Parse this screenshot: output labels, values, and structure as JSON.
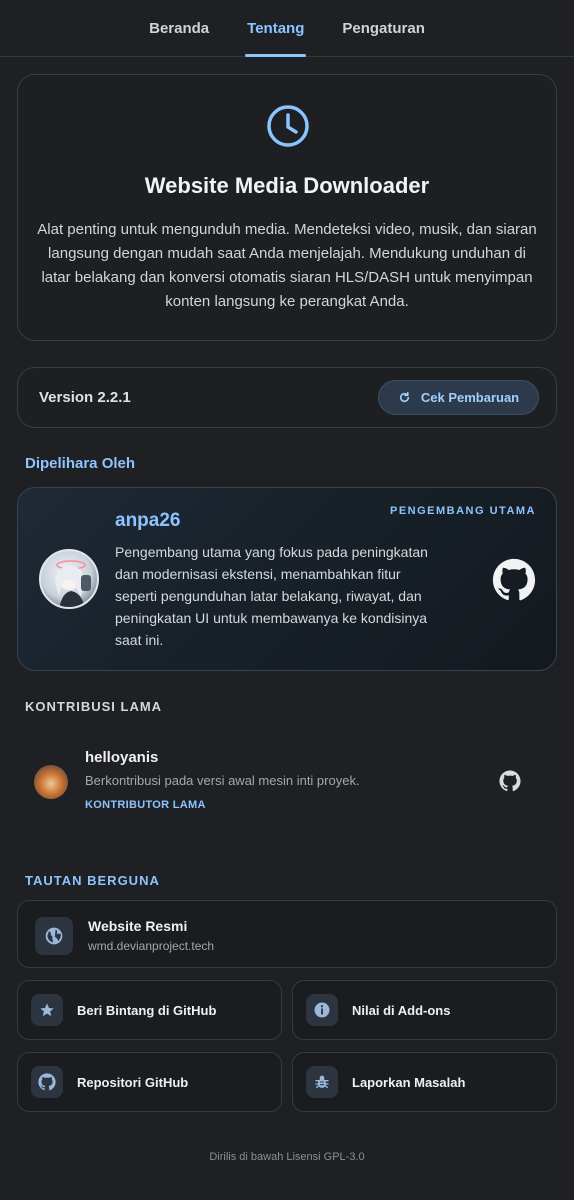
{
  "tabs": [
    {
      "label": "Beranda",
      "active": false
    },
    {
      "label": "Tentang",
      "active": true
    },
    {
      "label": "Pengaturan",
      "active": false
    }
  ],
  "hero": {
    "icon": "clock-icon",
    "title": "Website Media Downloader",
    "description": "Alat penting untuk mengunduh media. Mendeteksi video, musik, dan siaran langsung dengan mudah saat Anda menjelajah. Mendukung unduhan di latar belakang dan konversi otomatis siaran HLS/DASH untuk menyimpan konten langsung ke perangkat Anda."
  },
  "version": {
    "label": "Version 2.2.1",
    "update_button": "Cek Pembaruan"
  },
  "maintained": {
    "section_title": "Dipelihara Oleh",
    "name": "anpa26",
    "role": "PENGEMBANG UTAMA",
    "description": "Pengembang utama yang fokus pada peningkatan dan modernisasi ekstensi, menambahkan fitur seperti pengunduhan latar belakang, riwayat, dan peningkatan UI untuk membawanya ke kondisinya saat ini."
  },
  "legacy": {
    "section_title": "KONTRIBUSI LAMA",
    "name": "helloyanis",
    "description": "Berkontribusi pada versi awal mesin inti proyek.",
    "role": "KONTRIBUTOR LAMA"
  },
  "links": {
    "section_title": "TAUTAN BERGUNA",
    "website": {
      "label": "Website Resmi",
      "url": "wmd.devianproject.tech"
    },
    "star": "Beri Bintang di GitHub",
    "rate": "Nilai di Add-ons",
    "repo": "Repositori GitHub",
    "report": "Laporkan Masalah"
  },
  "footer": "Dirilis di bawah Lisensi GPL-3.0",
  "colors": {
    "accent": "#8cc4ff",
    "background": "#1f2023",
    "card_border": "#3a3d42"
  }
}
